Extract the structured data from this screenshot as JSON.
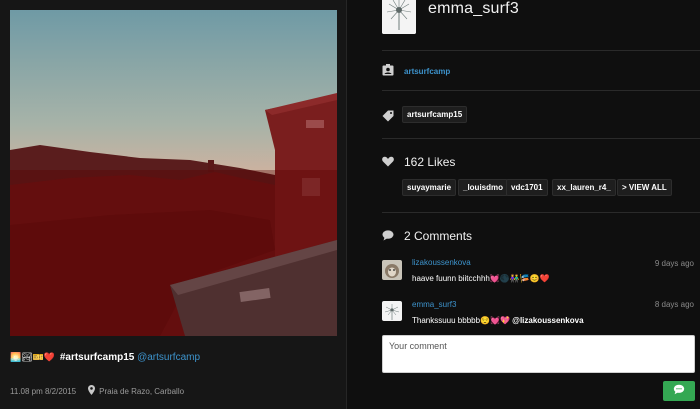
{
  "post": {
    "caption_emojis": "🌅🏞🎫❤️",
    "caption_hashtag": "#artsurfcamp15",
    "caption_mention": "@artsurfcamp",
    "time": "11.08 pm 8/2/2015",
    "location": "Praia de Razo, Carballo"
  },
  "profile": {
    "username": "emma_surf3"
  },
  "location_link": "artsurfcamp",
  "tag": "artsurfcamp15",
  "likes": {
    "title": "162 Likes",
    "users": [
      "suyaymarie",
      "_louisdmo",
      "vdc1701",
      "xx_lauren_r4_"
    ],
    "view_all": "> VIEW ALL"
  },
  "comments": {
    "title": "2 Comments",
    "items": [
      {
        "user": "lizakoussenkova",
        "time": "9 days ago",
        "text": "haave fuunn biitcchhh💓🌑👫🎏😊❤️"
      },
      {
        "user": "emma_surf3",
        "time": "8 days ago",
        "text": "Thankssuuu bbbbb😌💓💖 ",
        "mention": "@lizakoussenkova"
      }
    ]
  },
  "comment_input": {
    "placeholder": "Your comment"
  },
  "icons": {
    "location": "id-badge-icon",
    "tag": "tag-icon",
    "likes": "heart-icon",
    "comments": "speech-bubble-icon",
    "send": "chat-bubble-icon",
    "pin": "map-pin-icon"
  },
  "colors": {
    "link": "#3d93cc",
    "send_button": "#34a853",
    "background": "#0f0f0f"
  }
}
